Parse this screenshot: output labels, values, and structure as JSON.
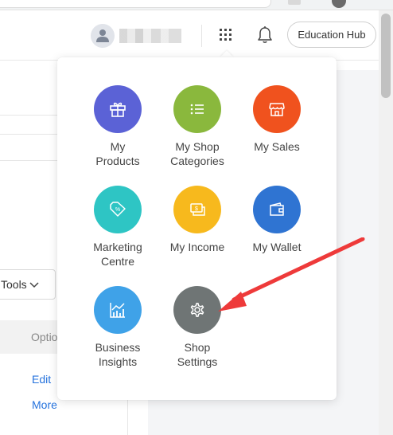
{
  "header": {
    "education_hub_label": "Education Hub"
  },
  "left_panel": {
    "tools_select_value": "Tools",
    "options_header": "Optio",
    "edit_link": "Edit",
    "more_link": "More"
  },
  "apps_menu": {
    "items": [
      {
        "label": "My\nProducts",
        "icon": "gift-box-icon",
        "color": "#5b62d6"
      },
      {
        "label": "My Shop\nCategories",
        "icon": "list-icon",
        "color": "#8ab83d"
      },
      {
        "label": "My Sales",
        "icon": "storefront-icon",
        "color": "#f0521e"
      },
      {
        "label": "Marketing\nCentre",
        "icon": "price-tag-icon",
        "color": "#2ec5c4"
      },
      {
        "label": "My Income",
        "icon": "money-icon",
        "color": "#f7b91d"
      },
      {
        "label": "My Wallet",
        "icon": "wallet-icon",
        "color": "#2f74d2"
      },
      {
        "label": "Business\nInsights",
        "icon": "bar-chart-icon",
        "color": "#3fa2e8"
      },
      {
        "label": "Shop\nSettings",
        "icon": "gear-icon",
        "color": "#6f7575"
      }
    ]
  },
  "annotation": {
    "arrow_color": "#ee3a3a",
    "points_to": "Shop Settings"
  }
}
